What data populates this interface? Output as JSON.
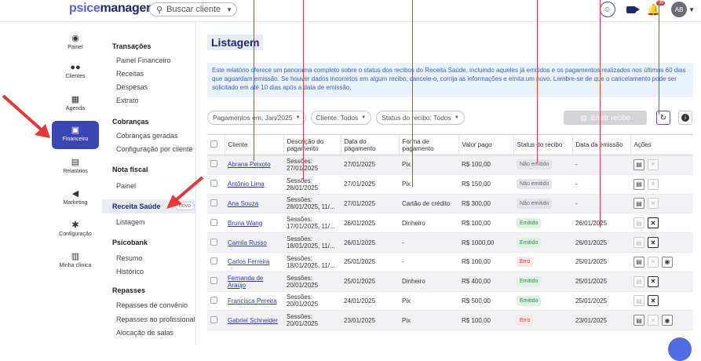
{
  "header": {
    "logo_a": "p",
    "logo_b": "sice",
    "logo_c": "manager",
    "search_label": "Buscar cliente",
    "notif_count": "99",
    "avatar_initials": "AB"
  },
  "rail": [
    {
      "label": "Painel",
      "icon": "gauge-icon",
      "glyph": "◉"
    },
    {
      "label": "Clientes",
      "icon": "users-icon",
      "glyph": "👥"
    },
    {
      "label": "Agenda",
      "icon": "calendar-icon",
      "glyph": "▦"
    },
    {
      "label": "Financeiro",
      "icon": "money-icon",
      "glyph": "▣"
    },
    {
      "label": "Relatórios",
      "icon": "file-icon",
      "glyph": "▤"
    },
    {
      "label": "Marketing",
      "icon": "megaphone-icon",
      "glyph": "◀"
    },
    {
      "label": "Configuração",
      "icon": "gear-icon",
      "glyph": "✱"
    },
    {
      "label": "Minha clínica",
      "icon": "building-icon",
      "glyph": "▥"
    }
  ],
  "submenu": {
    "transacoes": "Transações",
    "painel_financeiro": "Painel Financeiro",
    "receitas": "Receitas",
    "despesas": "Despesas",
    "extrato": "Extrato",
    "cobrancas": "Cobranças",
    "cobrancas_geradas": "Cobranças geradas",
    "config_cliente": "Configuração por cliente",
    "nota_fiscal": "Nota fiscal",
    "nf_painel": "Painel",
    "receita_saude": "Receita Saúde",
    "novo": "novo",
    "listagem": "Listagem",
    "psicobank": "Psicobank",
    "resumo": "Resumo",
    "historico": "Histórico",
    "repasses": "Repasses",
    "repasses_convenio": "Repasses de convênio",
    "repasses_profissional": "Repasses ao profissional",
    "alocacao": "Alocação de salas"
  },
  "main": {
    "title": "Listagem",
    "info": "Este relatório oferece um panorama completo sobre o status dos recibos do Receita Saúde, incluindo aqueles já emitidos e os pagamentos realizados nos últimos 60 dias que aguardam emissão. Se houver dados incorretos em algum recibo, cancele-o, corrija as informações e emita um novo. Lembre-se de que o cancelamento pode ser solicitado em até 10 dias após a data de emissão.",
    "filter_month": "Pagamentos em: Jan/2025",
    "filter_client": "Cliente: Todos",
    "filter_status": "Status do recibo: Todos",
    "emit_button": "Emitir recibo"
  },
  "table": {
    "headers": [
      "Cliente",
      "Descrição do pagamento",
      "Data do pagamento",
      "Forma de pagamento",
      "Valor pago",
      "Status do recibo",
      "Data da emissão",
      "Ações"
    ],
    "rows": [
      {
        "cliente": "Abrana Peixoto",
        "desc": "Sessões: 27/01/2025",
        "data": "27/01/2025",
        "forma": "Pix",
        "valor": "R$ 100,00",
        "status": "Não emitido",
        "st": "nao",
        "emissao": "-",
        "a": "v1"
      },
      {
        "cliente": "Antônio Lima",
        "desc": "Sessões: 28/01/2025",
        "data": "27/01/2025",
        "forma": "Pix",
        "valor": "R$ 150,00",
        "status": "Não emitido",
        "st": "nao",
        "emissao": "-",
        "a": "v1"
      },
      {
        "cliente": "Ana Souza",
        "desc": "Sessões: 28/01/2025, 11/...",
        "data": "27/01/2025",
        "forma": "Cartão de crédito",
        "valor": "R$ 300,00",
        "status": "Não emitido",
        "st": "nao",
        "emissao": "-",
        "a": "v1"
      },
      {
        "cliente": "Bruna Wang",
        "desc": "Sessões: 17/01/2025, 11/...",
        "data": "26/01/2025",
        "forma": "Dinheiro",
        "valor": "R$ 100,00",
        "status": "Emitido",
        "st": "emit",
        "emissao": "26/01/2025",
        "a": "v2"
      },
      {
        "cliente": "Camila Russo",
        "desc": "Sessões: 18/01/2025, 11/...",
        "data": "26/01/2025",
        "forma": "-",
        "valor": "R$ 1000,00",
        "status": "Emitido",
        "st": "emit",
        "emissao": "26/01/2025",
        "a": "v2"
      },
      {
        "cliente": "Carlos Ferreira",
        "desc": "Sessões: 18/01/2025, 11/...",
        "data": "25/01/2025",
        "forma": "-",
        "valor": "R$ 100,00",
        "status": "Erro",
        "st": "erro",
        "emissao": "25/01/2025",
        "a": "v3"
      },
      {
        "cliente": "Fernanda de Araújo",
        "desc": "Sessões: 20/01/2025",
        "data": "25/01/2025",
        "forma": "Dinheiro",
        "valor": "R$ 400,00",
        "status": "Emitido",
        "st": "emit",
        "emissao": "25/01/2025",
        "a": "v2"
      },
      {
        "cliente": "Francisca Pereira",
        "desc": "Sessões: 20/01/2025",
        "data": "24/01/2025",
        "forma": "Pix",
        "valor": "R$ 500,00",
        "status": "Emitido",
        "st": "emit",
        "emissao": "25/01/2025",
        "a": "v2"
      },
      {
        "cliente": "Gabriel Schneider",
        "desc": "Sessões: 20/01/2025",
        "data": "23/01/2025",
        "forma": "Pix",
        "valor": "R$ 100,00",
        "status": "Erro",
        "st": "erro",
        "emissao": "23/01/2025",
        "a": "v3"
      }
    ]
  },
  "colors": {
    "primary": "#3a46b2",
    "annotation": "#e23a3a"
  }
}
